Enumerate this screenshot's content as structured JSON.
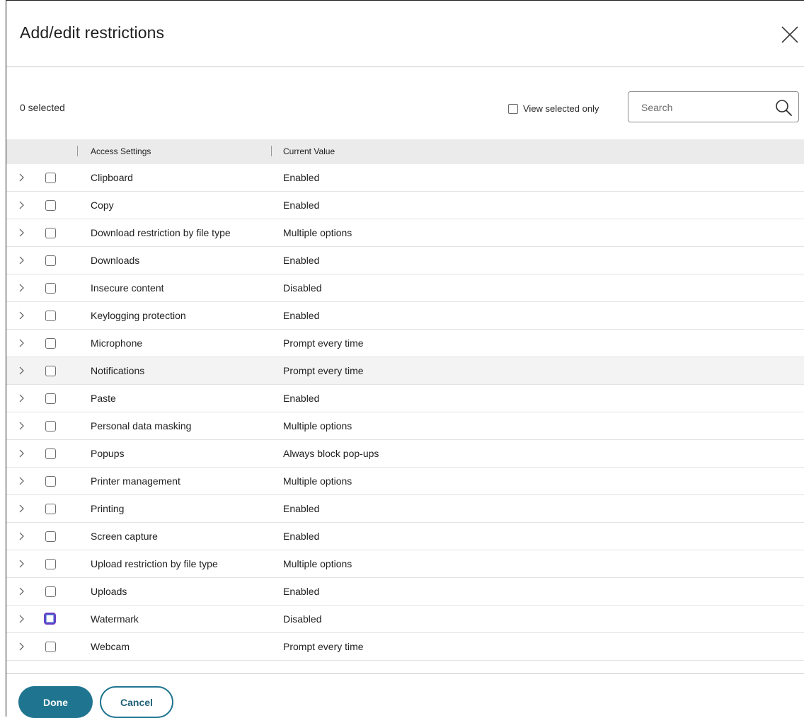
{
  "dialog": {
    "title": "Add/edit restrictions"
  },
  "toolbar": {
    "selected_count": "0 selected",
    "view_selected_label": "View selected only",
    "search_placeholder": "Search"
  },
  "table": {
    "columns": [
      "Access Settings",
      "Current Value"
    ],
    "rows": [
      {
        "setting": "Clipboard",
        "value": "Enabled"
      },
      {
        "setting": "Copy",
        "value": "Enabled"
      },
      {
        "setting": "Download restriction by file type",
        "value": "Multiple options"
      },
      {
        "setting": "Downloads",
        "value": "Enabled"
      },
      {
        "setting": "Insecure content",
        "value": "Disabled"
      },
      {
        "setting": "Keylogging protection",
        "value": "Enabled"
      },
      {
        "setting": "Microphone",
        "value": "Prompt every time"
      },
      {
        "setting": "Notifications",
        "value": "Prompt every time"
      },
      {
        "setting": "Paste",
        "value": "Enabled"
      },
      {
        "setting": "Personal data masking",
        "value": "Multiple options"
      },
      {
        "setting": "Popups",
        "value": "Always block pop-ups"
      },
      {
        "setting": "Printer management",
        "value": "Multiple options"
      },
      {
        "setting": "Printing",
        "value": "Enabled"
      },
      {
        "setting": "Screen capture",
        "value": "Enabled"
      },
      {
        "setting": "Upload restriction by file type",
        "value": "Multiple options"
      },
      {
        "setting": "Uploads",
        "value": "Enabled"
      },
      {
        "setting": "Watermark",
        "value": "Disabled"
      },
      {
        "setting": "Webcam",
        "value": "Prompt every time"
      }
    ]
  },
  "footer": {
    "done_label": "Done",
    "cancel_label": "Cancel"
  },
  "colors": {
    "primary": "#1f7590",
    "header_bg": "#ebebeb",
    "focus_ring": "#6d3ec7"
  }
}
